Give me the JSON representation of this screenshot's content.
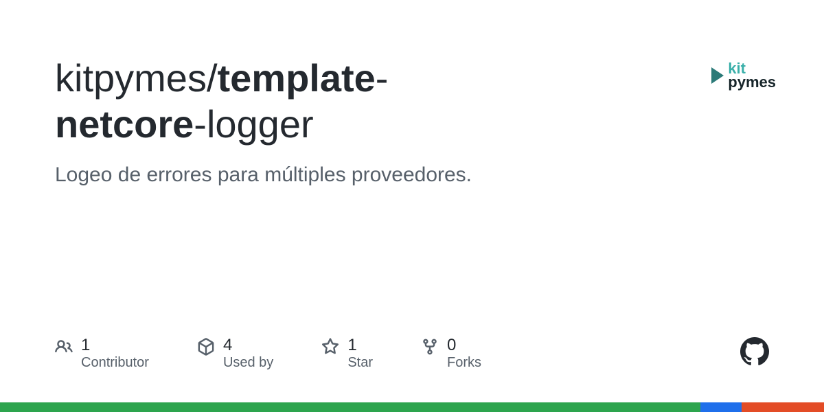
{
  "repo": {
    "owner": "kitpymes",
    "name_bold": "template",
    "name_light1": "-",
    "name_light2": "netcore",
    "name_light3": "-logger"
  },
  "description": "Logeo de errores para múltiples proveedores.",
  "logo": {
    "kit": "kit",
    "pymes": "pymes"
  },
  "stats": [
    {
      "value": "1",
      "label": "Contributor"
    },
    {
      "value": "4",
      "label": "Used by"
    },
    {
      "value": "1",
      "label": "Star"
    },
    {
      "value": "0",
      "label": "Forks"
    }
  ],
  "bar_colors": [
    {
      "color": "#2da44e",
      "flex": 85
    },
    {
      "color": "#1f6feb",
      "flex": 5
    },
    {
      "color": "#e34c26",
      "flex": 10
    }
  ]
}
